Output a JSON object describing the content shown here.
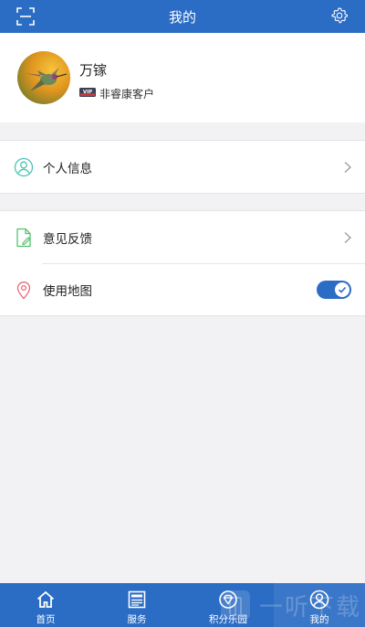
{
  "header": {
    "title": "我的",
    "left_icon": "scan-icon",
    "right_icon": "gear-icon"
  },
  "profile": {
    "name": "万镓",
    "badge": "VIP",
    "level": "非睿康客户"
  },
  "menu_groups": [
    {
      "items": [
        {
          "label": "个人信息",
          "icon": "user-icon",
          "action": "chevron"
        }
      ]
    },
    {
      "items": [
        {
          "label": "意见反馈",
          "icon": "feedback-icon",
          "action": "chevron"
        },
        {
          "label": "使用地图",
          "icon": "location-icon",
          "action": "toggle",
          "toggle_on": true
        }
      ]
    }
  ],
  "tabbar": {
    "tabs": [
      {
        "label": "首页",
        "icon": "home-icon",
        "active": false
      },
      {
        "label": "服务",
        "icon": "service-icon",
        "active": false
      },
      {
        "label": "积分乐园",
        "icon": "points-icon",
        "active": false
      },
      {
        "label": "我的",
        "icon": "profile-icon",
        "active": true
      }
    ]
  },
  "watermark": {
    "text": "一听下载"
  },
  "colors": {
    "primary": "#2b6cc4",
    "background": "#f2f2f4",
    "user_icon": "#4cc3b5",
    "feedback_icon": "#55c26a",
    "location_icon": "#e86a7a"
  }
}
